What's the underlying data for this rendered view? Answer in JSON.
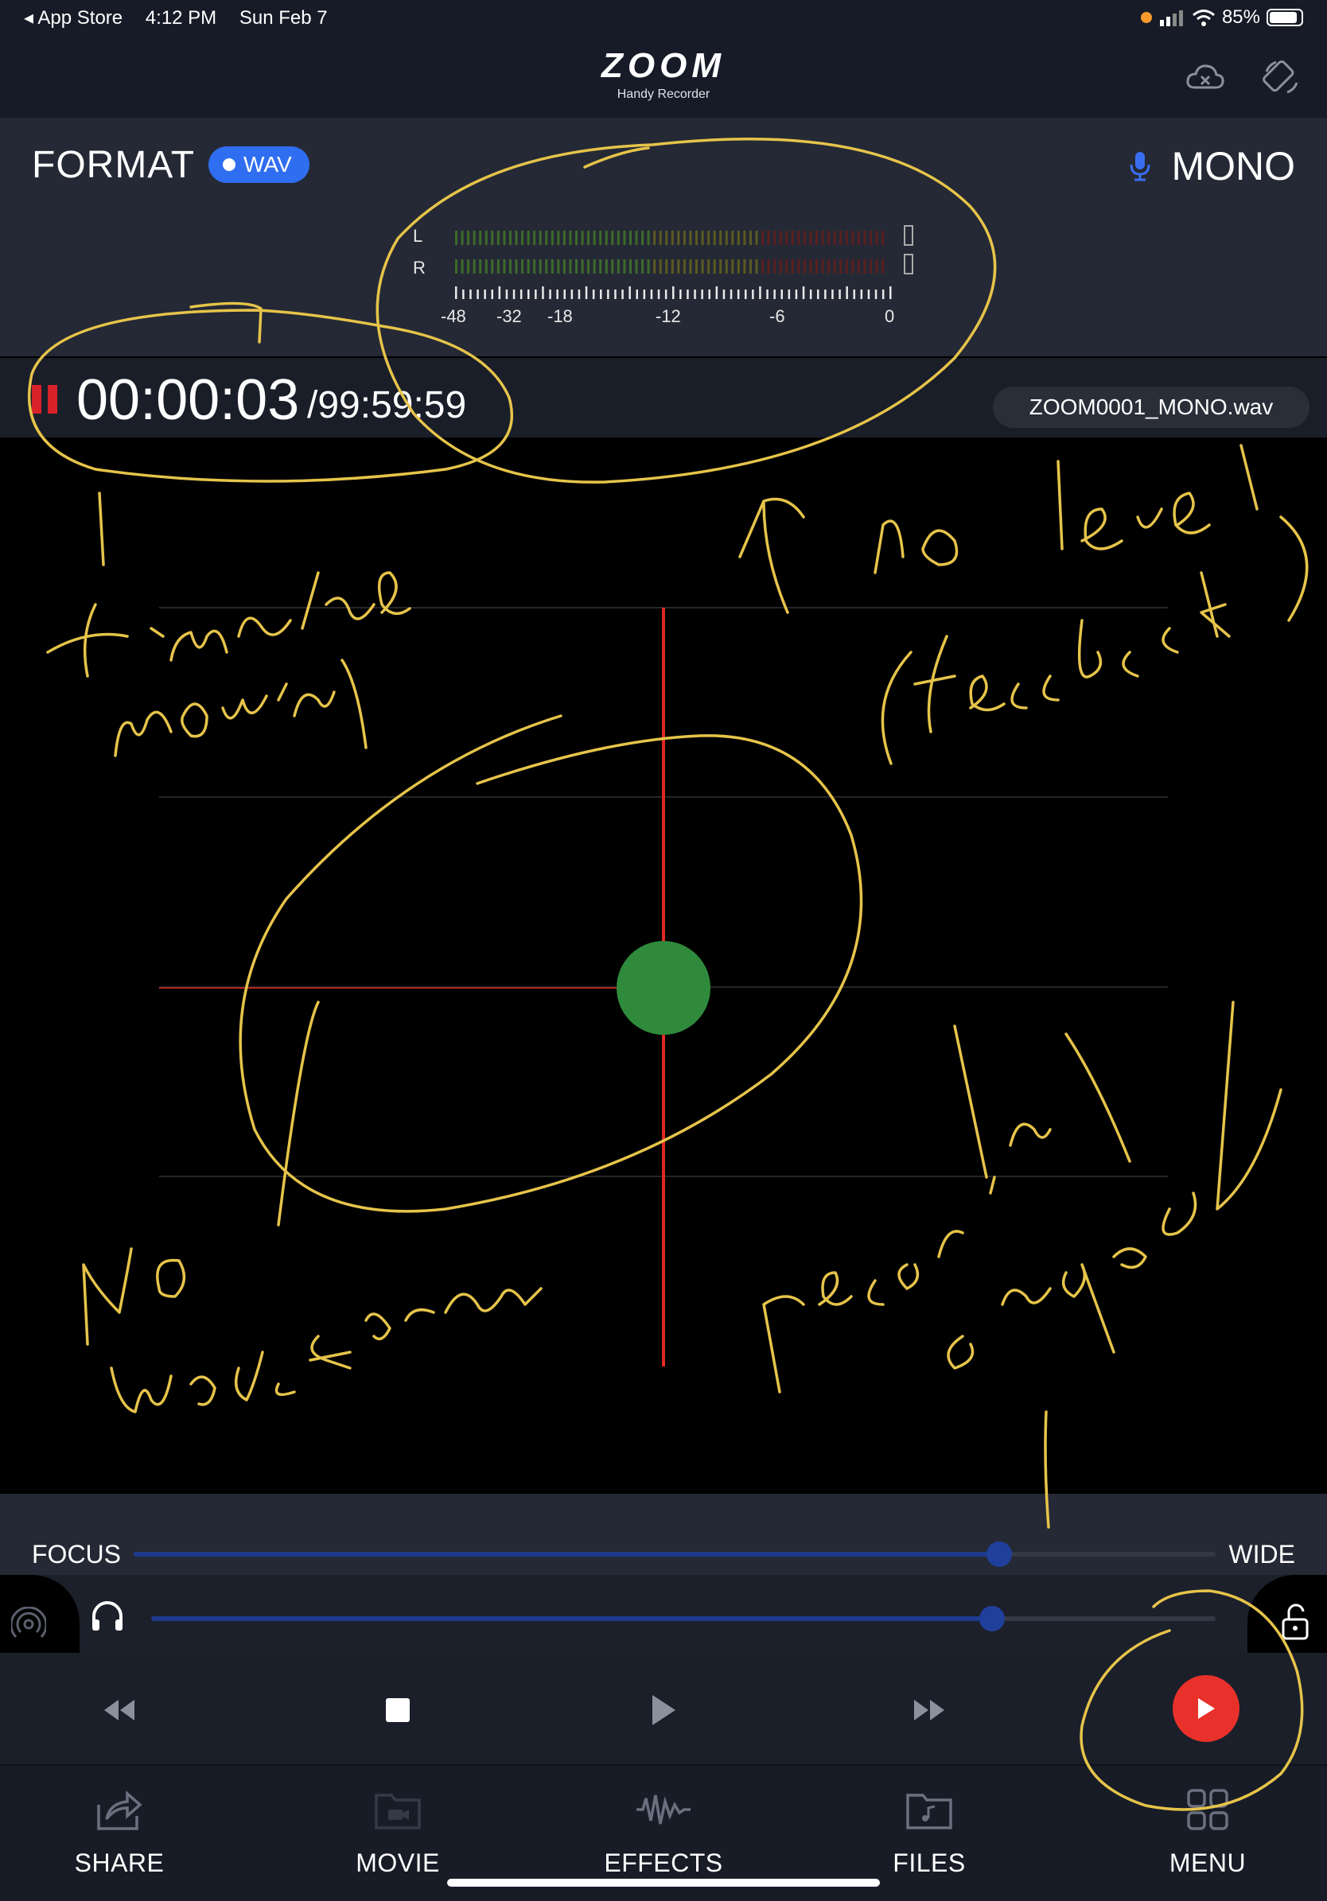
{
  "status_bar": {
    "back_app": "App Store",
    "time": "4:12 PM",
    "date": "Sun Feb 7",
    "battery": "85%"
  },
  "header": {
    "brand": "ZOOM",
    "subtitle": "Handy Recorder"
  },
  "format": {
    "title": "FORMAT",
    "badge": "WAV",
    "channel": "MONO"
  },
  "level_meter": {
    "left_label": "L",
    "right_label": "R",
    "ticks": [
      "-48",
      "-32",
      "-18",
      "-12",
      "-6",
      "0"
    ]
  },
  "timer": {
    "elapsed": "00:00:03",
    "total": "/99:59:59",
    "filename": "ZOOM0001_MONO.wav"
  },
  "sliders": {
    "focus_label": "FOCUS",
    "wide_label": "WIDE",
    "focus_value": 0.8,
    "volume_value": 0.79
  },
  "tabs": [
    {
      "label": "SHARE"
    },
    {
      "label": "MOVIE"
    },
    {
      "label": "EFFECTS"
    },
    {
      "label": "FILES"
    },
    {
      "label": "MENU"
    }
  ],
  "annotations": {
    "a1": "timeline moving",
    "a2": "no level (feedback)",
    "a3": "No waveform",
    "a4": "recording engaged"
  },
  "colors": {
    "accent_blue": "#2f6ef0",
    "record_red": "#e8312a",
    "playhead_red": "#e0281f",
    "annotation_yellow": "#e6c44a",
    "input_green": "#2f8a3c"
  }
}
